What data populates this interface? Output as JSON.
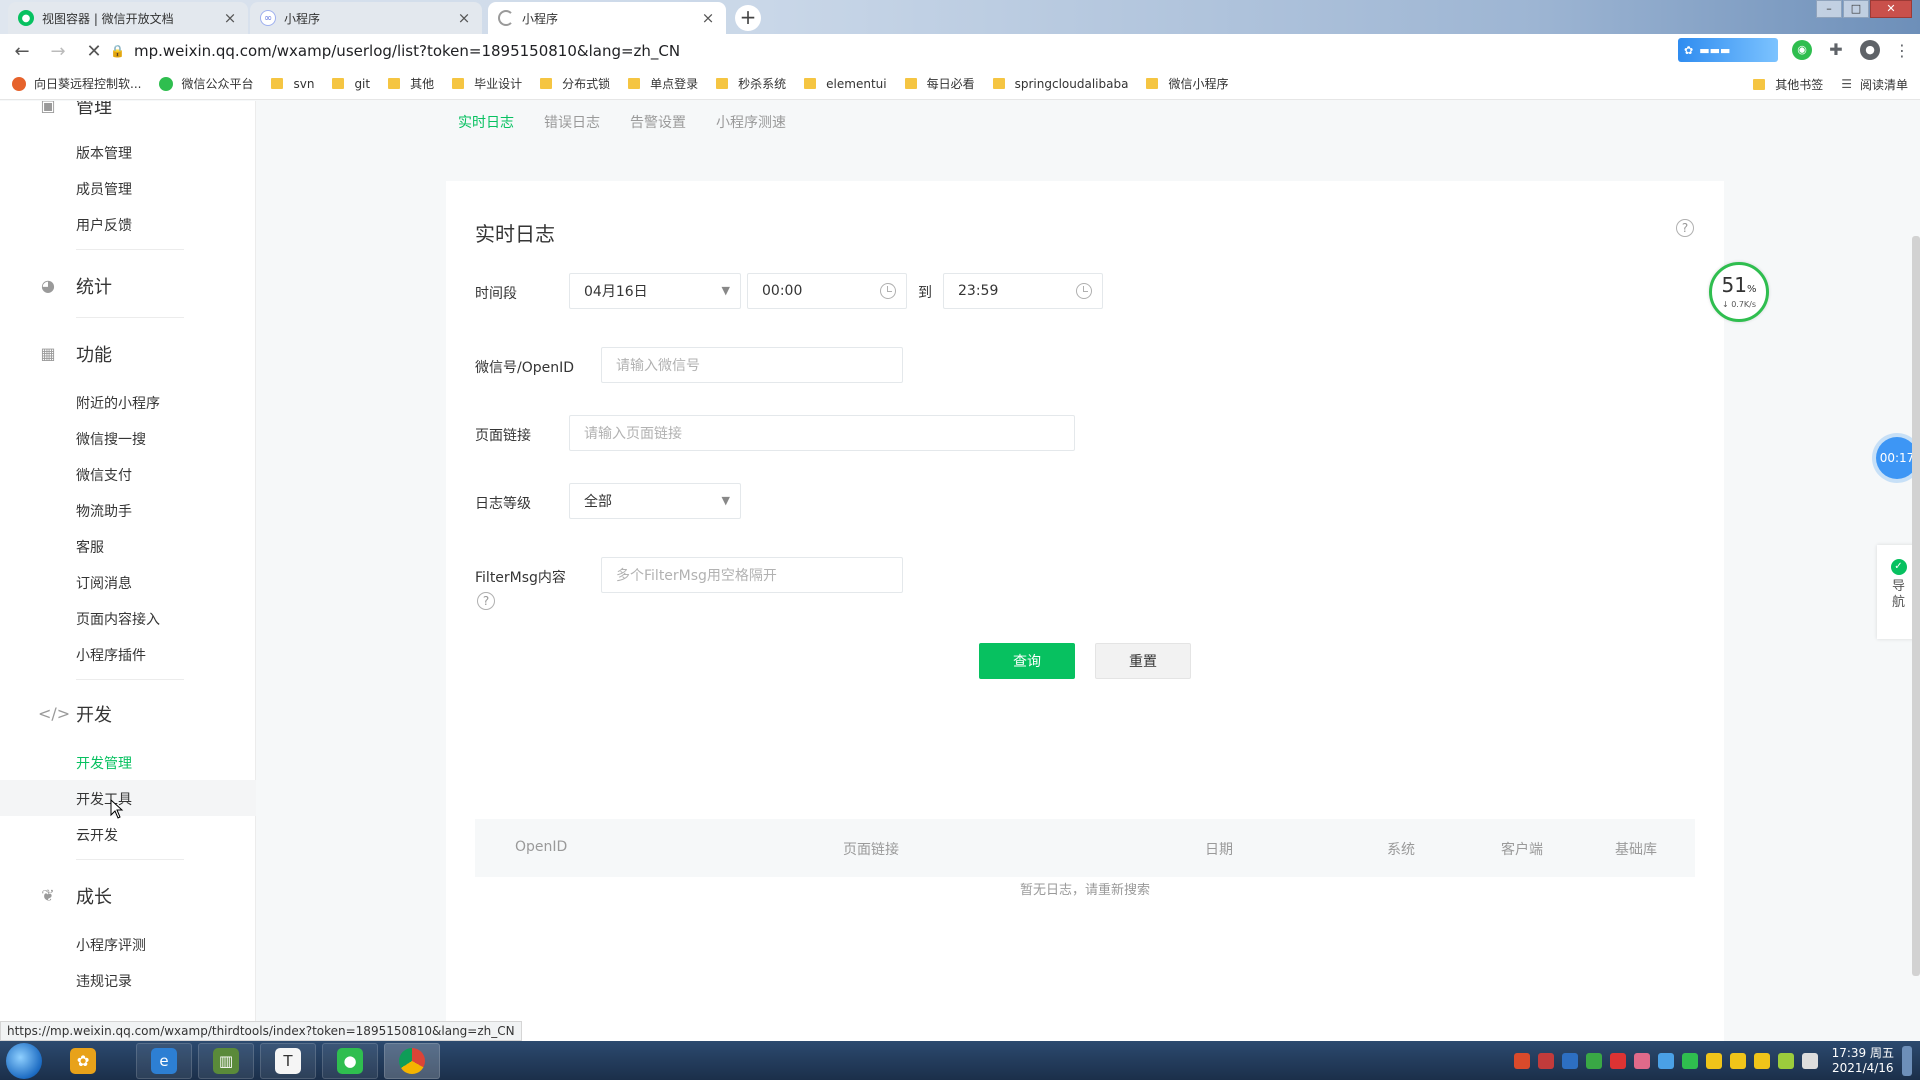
{
  "browser": {
    "tabs": [
      {
        "title": "视图容器 | 微信开放文档",
        "close": "×",
        "active": false
      },
      {
        "title": "小程序",
        "close": "×",
        "active": false
      },
      {
        "title": "小程序",
        "close": "×",
        "active": true
      }
    ],
    "new_tab": "+",
    "url": "mp.weixin.qq.com/wxamp/userlog/list?token=1895150810&lang=zh_CN",
    "bookmarks": [
      {
        "label": "向日葵远程控制软...",
        "icon": "sunflower-icon"
      },
      {
        "label": "微信公众平台",
        "icon": "wechat-icon"
      },
      {
        "label": "svn",
        "icon": "folder-icon"
      },
      {
        "label": "git",
        "icon": "folder-icon"
      },
      {
        "label": "其他",
        "icon": "folder-icon"
      },
      {
        "label": "毕业设计",
        "icon": "folder-icon"
      },
      {
        "label": "分布式锁",
        "icon": "folder-icon"
      },
      {
        "label": "单点登录",
        "icon": "folder-icon"
      },
      {
        "label": "秒杀系统",
        "icon": "folder-icon"
      },
      {
        "label": "elementui",
        "icon": "folder-icon"
      },
      {
        "label": "每日必看",
        "icon": "folder-icon"
      },
      {
        "label": "springcloudalibaba",
        "icon": "folder-icon"
      },
      {
        "label": "微信小程序",
        "icon": "folder-icon"
      }
    ],
    "bookmarks_right": [
      {
        "label": "其他书签",
        "icon": "folder-icon"
      },
      {
        "label": "阅读清单",
        "icon": "reading-list-icon"
      }
    ],
    "status_url": "https://mp.weixin.qq.com/wxamp/thirdtools/index?token=1895150810&lang=zh_CN"
  },
  "sidebar": {
    "partial_section": "管理",
    "sections": [
      {
        "key": "manage",
        "items": [
          "版本管理",
          "成员管理",
          "用户反馈"
        ]
      },
      {
        "key": "stats",
        "label": "统计",
        "icon": "pie-chart-icon",
        "items": []
      },
      {
        "key": "features",
        "label": "功能",
        "icon": "grid-icon",
        "items": [
          "附近的小程序",
          "微信搜一搜",
          "微信支付",
          "物流助手",
          "客服",
          "订阅消息",
          "页面内容接入",
          "小程序插件"
        ]
      },
      {
        "key": "dev",
        "label": "开发",
        "icon": "code-icon",
        "items": [
          "开发管理",
          "开发工具",
          "云开发"
        ]
      },
      {
        "key": "growth",
        "label": "成长",
        "icon": "sprout-icon",
        "items": [
          "小程序评测",
          "违规记录"
        ]
      }
    ],
    "active_item": "开发管理",
    "hovered_item": "开发工具"
  },
  "top_tabs": [
    "实时日志",
    "错误日志",
    "告警设置",
    "小程序测速"
  ],
  "form": {
    "title": "实时日志",
    "time_label": "时间段",
    "date_value": "04月16日",
    "start_time": "00:00",
    "to_label": "到",
    "end_time": "23:59",
    "openid_label": "微信号/OpenID",
    "openid_placeholder": "请输入微信号",
    "page_label": "页面链接",
    "page_placeholder": "请输入页面链接",
    "level_label": "日志等级",
    "level_value": "全部",
    "filter_label": "FilterMsg内容",
    "filter_placeholder": "多个FilterMsg用空格隔开",
    "query_button": "查询",
    "reset_button": "重置",
    "help": "?"
  },
  "table": {
    "columns": [
      "OpenID",
      "页面链接",
      "日期",
      "系统",
      "客户端",
      "基础库"
    ],
    "empty_text": "暂无日志，请重新搜索"
  },
  "widgets": {
    "speed_percent": "51",
    "speed_unit": "%",
    "speed_rate": "↓ 0.7K/s",
    "timer": "00:17",
    "guide_label": "导航"
  },
  "taskbar": {
    "time": "17:39 周五",
    "date": "2021/4/16"
  },
  "colors": {
    "accent": "#07c160",
    "timer_blue": "#3d96f5"
  }
}
